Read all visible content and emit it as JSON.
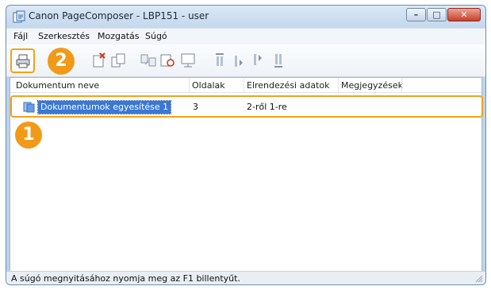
{
  "window": {
    "title": "Canon PageComposer - LBP151 - user",
    "buttons": {
      "minimize": "–",
      "maximize": "□",
      "close": "✕"
    }
  },
  "menubar": [
    "Fájl",
    "Szerkesztés",
    "Mozgatás",
    "Súgó"
  ],
  "callouts": {
    "one": "1",
    "two": "2"
  },
  "list": {
    "columns": [
      "Dokumentum neve",
      "Oldalak",
      "Elrendezési adatok",
      "Megjegyzések"
    ],
    "rows": [
      {
        "name": "Dokumentumok egyesítése 1",
        "pages": "3",
        "layout": "2-ről 1-re",
        "notes": ""
      }
    ]
  },
  "status": "A súgó megnyitásához nyomja meg az F1 billentyűt.",
  "colors": {
    "highlight": "#f3a21a",
    "selection": "#3a78d6",
    "callout": "#f29a18"
  },
  "icons": [
    "print-icon",
    "delete-icon",
    "copy-icon",
    "combine-icon",
    "undo-combine-icon",
    "details-icon",
    "move-top-icon",
    "move-up-icon",
    "move-down-icon",
    "move-bottom-icon"
  ]
}
